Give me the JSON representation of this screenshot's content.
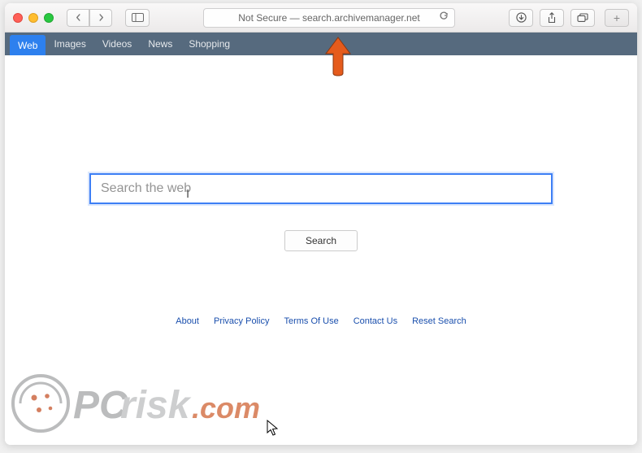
{
  "address_bar": {
    "text": "Not Secure — search.archivemanager.net"
  },
  "nav_tabs": {
    "items": [
      {
        "label": "Web",
        "active": true
      },
      {
        "label": "Images",
        "active": false
      },
      {
        "label": "Videos",
        "active": false
      },
      {
        "label": "News",
        "active": false
      },
      {
        "label": "Shopping",
        "active": false
      }
    ]
  },
  "search": {
    "placeholder": "Search the web",
    "button_label": "Search"
  },
  "footer": {
    "links": [
      {
        "label": "About"
      },
      {
        "label": "Privacy Policy"
      },
      {
        "label": "Terms Of Use"
      },
      {
        "label": "Contact Us"
      },
      {
        "label": "Reset Search"
      }
    ]
  },
  "watermark": {
    "brand_part1": "PC",
    "brand_part2": "risk",
    "brand_tld": ".com"
  }
}
